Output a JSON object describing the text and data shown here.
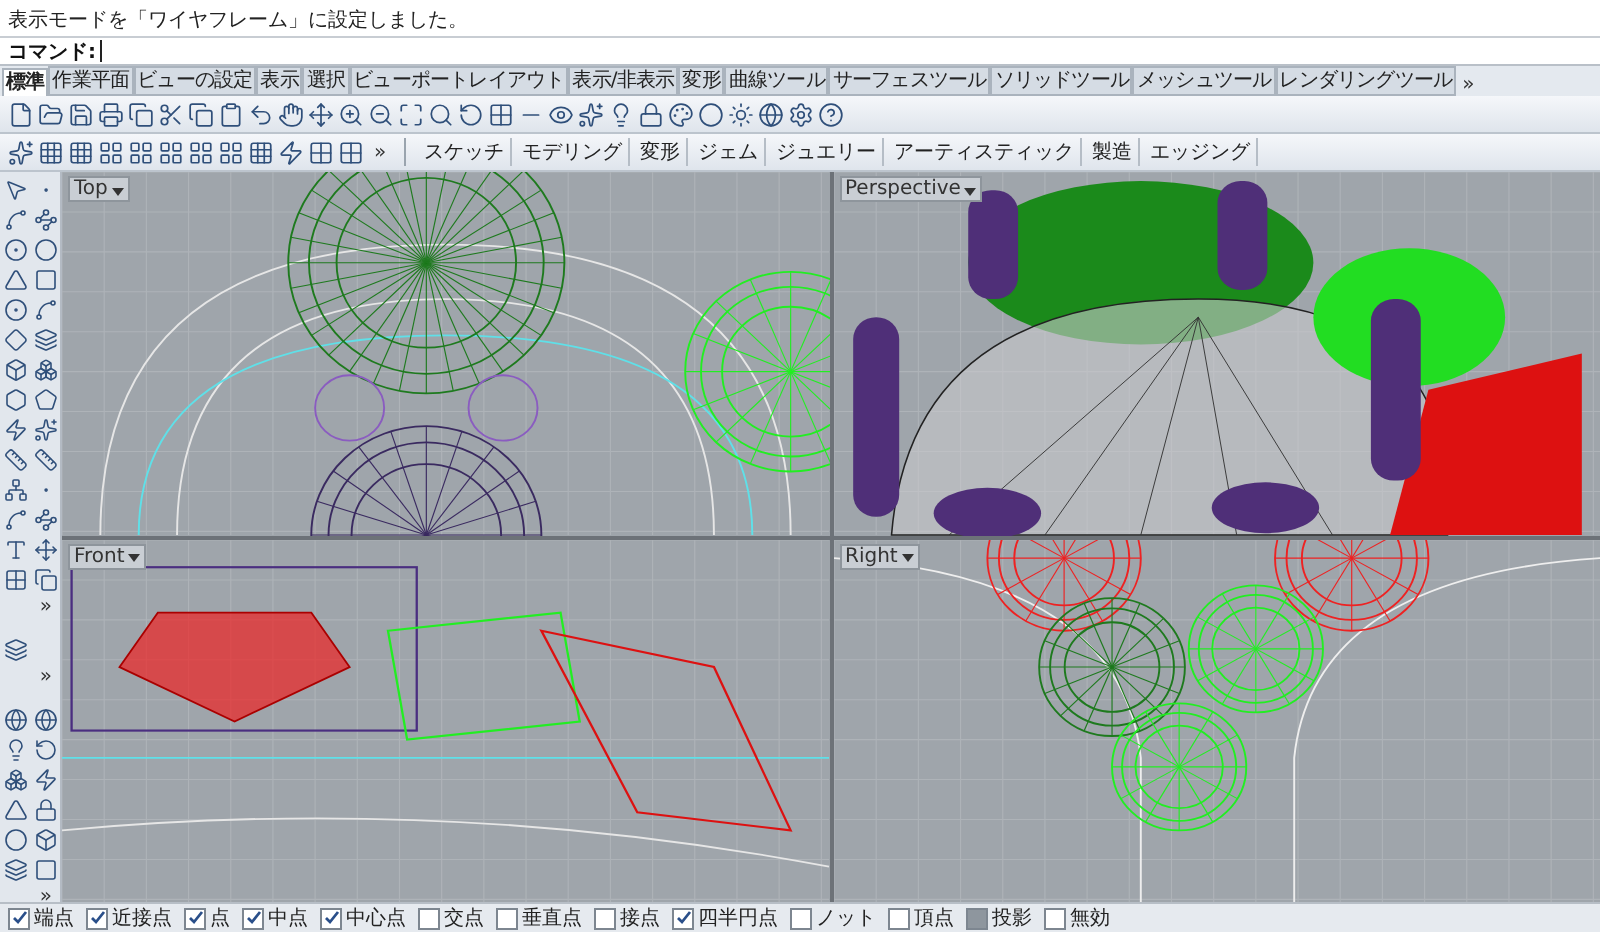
{
  "command_history": [
    "表示モードを「ワイヤフレーム」に設定しました。"
  ],
  "command_prompt": {
    "label": "コマンド:"
  },
  "tabs": [
    {
      "label": "標準",
      "selected": true
    },
    {
      "label": "作業平面",
      "selected": false
    },
    {
      "label": "ビューの設定",
      "selected": false
    },
    {
      "label": "表示",
      "selected": false
    },
    {
      "label": "選択",
      "selected": false
    },
    {
      "label": "ビューポートレイアウト",
      "selected": false
    },
    {
      "label": "表示/非表示",
      "selected": false
    },
    {
      "label": "変形",
      "selected": false
    },
    {
      "label": "曲線ツール",
      "selected": false
    },
    {
      "label": "サーフェスツール",
      "selected": false
    },
    {
      "label": "ソリッドツール",
      "selected": false
    },
    {
      "label": "メッシュツール",
      "selected": false
    },
    {
      "label": "レンダリングツール",
      "selected": false
    }
  ],
  "tabs_more": "»",
  "toolbar_more": "»",
  "macro_buttons": [
    "スケッチ",
    "モデリング",
    "変形",
    "ジェム",
    "ジュエリー",
    "アーティスティック",
    "製造",
    "エッジング"
  ],
  "sidebar_more": [
    "»",
    "»",
    "»"
  ],
  "viewports": [
    {
      "title": "Top",
      "kind": "top"
    },
    {
      "title": "Perspective",
      "kind": "perspective"
    },
    {
      "title": "Front",
      "kind": "front"
    },
    {
      "title": "Right",
      "kind": "right"
    }
  ],
  "osnaps": [
    {
      "label": "端点",
      "checked": true,
      "kind": "check"
    },
    {
      "label": "近接点",
      "checked": true,
      "kind": "check"
    },
    {
      "label": "点",
      "checked": true,
      "kind": "check"
    },
    {
      "label": "中点",
      "checked": true,
      "kind": "check"
    },
    {
      "label": "中心点",
      "checked": true,
      "kind": "check"
    },
    {
      "label": "交点",
      "checked": false,
      "kind": "check"
    },
    {
      "label": "垂直点",
      "checked": false,
      "kind": "check"
    },
    {
      "label": "接点",
      "checked": false,
      "kind": "check"
    },
    {
      "label": "四半円点",
      "checked": true,
      "kind": "check"
    },
    {
      "label": "ノット",
      "checked": false,
      "kind": "check"
    },
    {
      "label": "頂点",
      "checked": false,
      "kind": "check"
    },
    {
      "label": "投影",
      "checked": true,
      "kind": "toggle"
    },
    {
      "label": "無効",
      "checked": false,
      "kind": "toggle"
    }
  ]
}
